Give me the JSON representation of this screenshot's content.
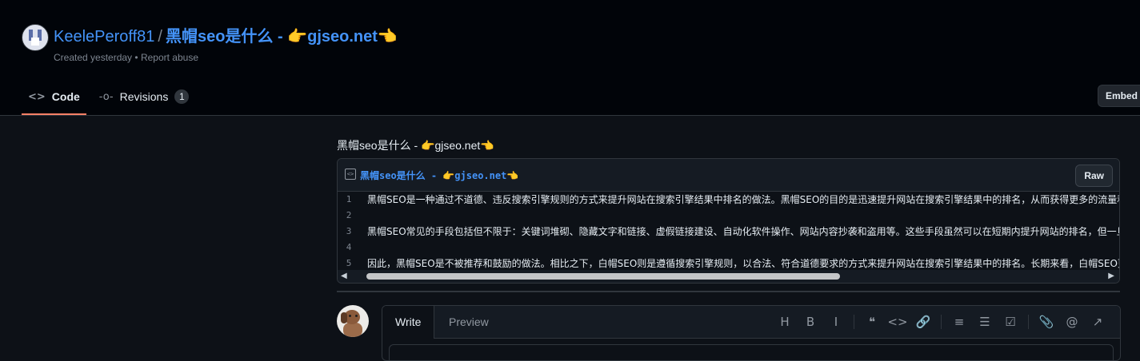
{
  "header": {
    "owner": "KeelePeroff81",
    "separator": "/",
    "gist_title": "黑帽seo是什么 - 👉gjseo.net👈",
    "meta": {
      "created": "Created yesterday",
      "dot": "•",
      "report": "Report abuse"
    },
    "tabs": [
      {
        "label": "Code",
        "icon": "code-icon"
      },
      {
        "label": "Revisions",
        "icon": "git-commit-icon",
        "count": "1"
      }
    ],
    "embed_label": "Embed"
  },
  "description": "黑帽seo是什么 - 👉gjseo.net👈",
  "file": {
    "name": "黑帽seo是什么 - 👉gjseo.net👈",
    "raw_label": "Raw",
    "lines": [
      {
        "n": "1",
        "text": "黑帽SEO是一种通过不道德、违反搜索引擎规则的方式来提升网站在搜索引擎结果中排名的做法。黑帽SEO的目的是迅速提升网站在搜索引擎结果中的排名，从而获得更多的流量和"
      },
      {
        "n": "2",
        "text": ""
      },
      {
        "n": "3",
        "text": "黑帽SEO常见的手段包括但不限于：关键词堆砌、隐藏文字和链接、虚假链接建设、自动化软件操作、网站内容抄袭和盗用等。这些手段虽然可以在短期内提升网站的排名，但一旦"
      },
      {
        "n": "4",
        "text": ""
      },
      {
        "n": "5",
        "text": "因此，黑帽SEO是不被推荐和鼓励的做法。相比之下，白帽SEO则是遵循搜索引擎规则，以合法、符合道德要求的方式来提升网站在搜索引擎结果中的排名。长期来看，白帽SEO更有"
      }
    ]
  },
  "comment": {
    "write_label": "Write",
    "preview_label": "Preview",
    "toolbar": [
      {
        "name": "heading-icon",
        "glyph": "H"
      },
      {
        "name": "bold-icon",
        "glyph": "B"
      },
      {
        "name": "italic-icon",
        "glyph": "I"
      },
      {
        "name": "quote-icon",
        "glyph": "❝"
      },
      {
        "name": "code-icon",
        "glyph": "<>"
      },
      {
        "name": "link-icon",
        "glyph": "🔗"
      },
      {
        "name": "numbered-list-icon",
        "glyph": "≡"
      },
      {
        "name": "unordered-list-icon",
        "glyph": "☰"
      },
      {
        "name": "task-list-icon",
        "glyph": "☑"
      },
      {
        "name": "attach-icon",
        "glyph": "📎"
      },
      {
        "name": "mention-icon",
        "glyph": "@"
      },
      {
        "name": "reference-icon",
        "glyph": "↗"
      }
    ]
  },
  "colors": {
    "accent_link": "#4493f8",
    "active_tab_underline": "#f78166",
    "background": "#0d1117"
  }
}
